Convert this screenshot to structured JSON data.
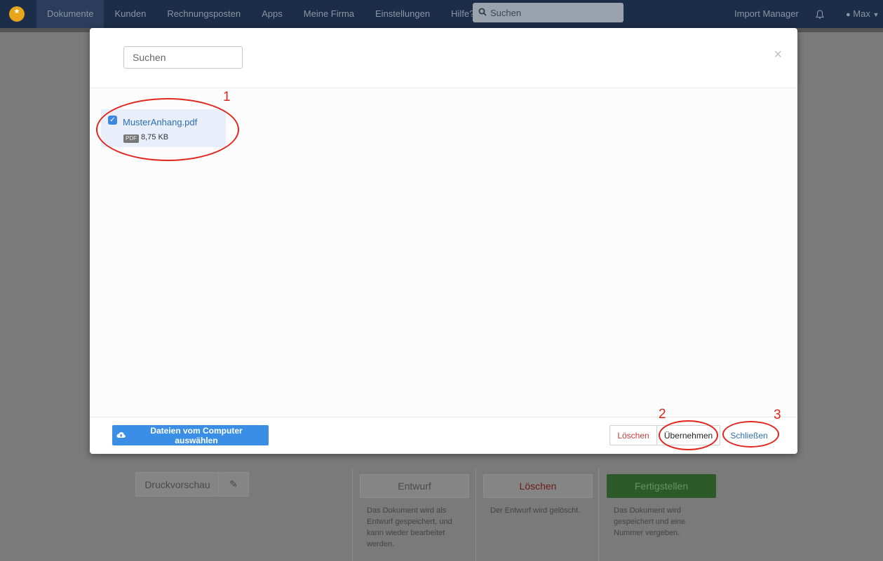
{
  "navbar": {
    "logo": "*",
    "items": [
      "Dokumente",
      "Kunden",
      "Rechnungsposten",
      "Apps",
      "Meine Firma",
      "Einstellungen",
      "Hilfe?"
    ],
    "search_placeholder": "Suchen",
    "import_manager": "Import Manager",
    "bell_icon": "bell-icon",
    "user": "Max"
  },
  "background": {
    "print_preview": "Druckvorschau",
    "draft_btn": "Entwurf",
    "delete_btn": "Löschen",
    "finish_btn": "Fertigstellen",
    "draft_desc": "Das Dokument wird als Entwurf gespeichert, und kann wieder bearbeitet werden.",
    "delete_desc": "Der Entwurf wird gelöscht.",
    "finish_desc": "Das Dokument wird gespeichert und eine Nummer vergeben."
  },
  "modal": {
    "search_placeholder": "Suchen",
    "close_symbol": "×",
    "file": {
      "name": "MusterAnhang.pdf",
      "type": "PDF",
      "size": "8,75 KB",
      "checked": true
    },
    "footer": {
      "upload_label": "Dateien vom Computer auswählen",
      "delete_label": "Löschen",
      "accept_label": "Übernehmen",
      "close_label": "Schließen"
    }
  },
  "annotations": {
    "one": "1",
    "two": "2",
    "three": "3",
    "color": "#e0261d"
  }
}
